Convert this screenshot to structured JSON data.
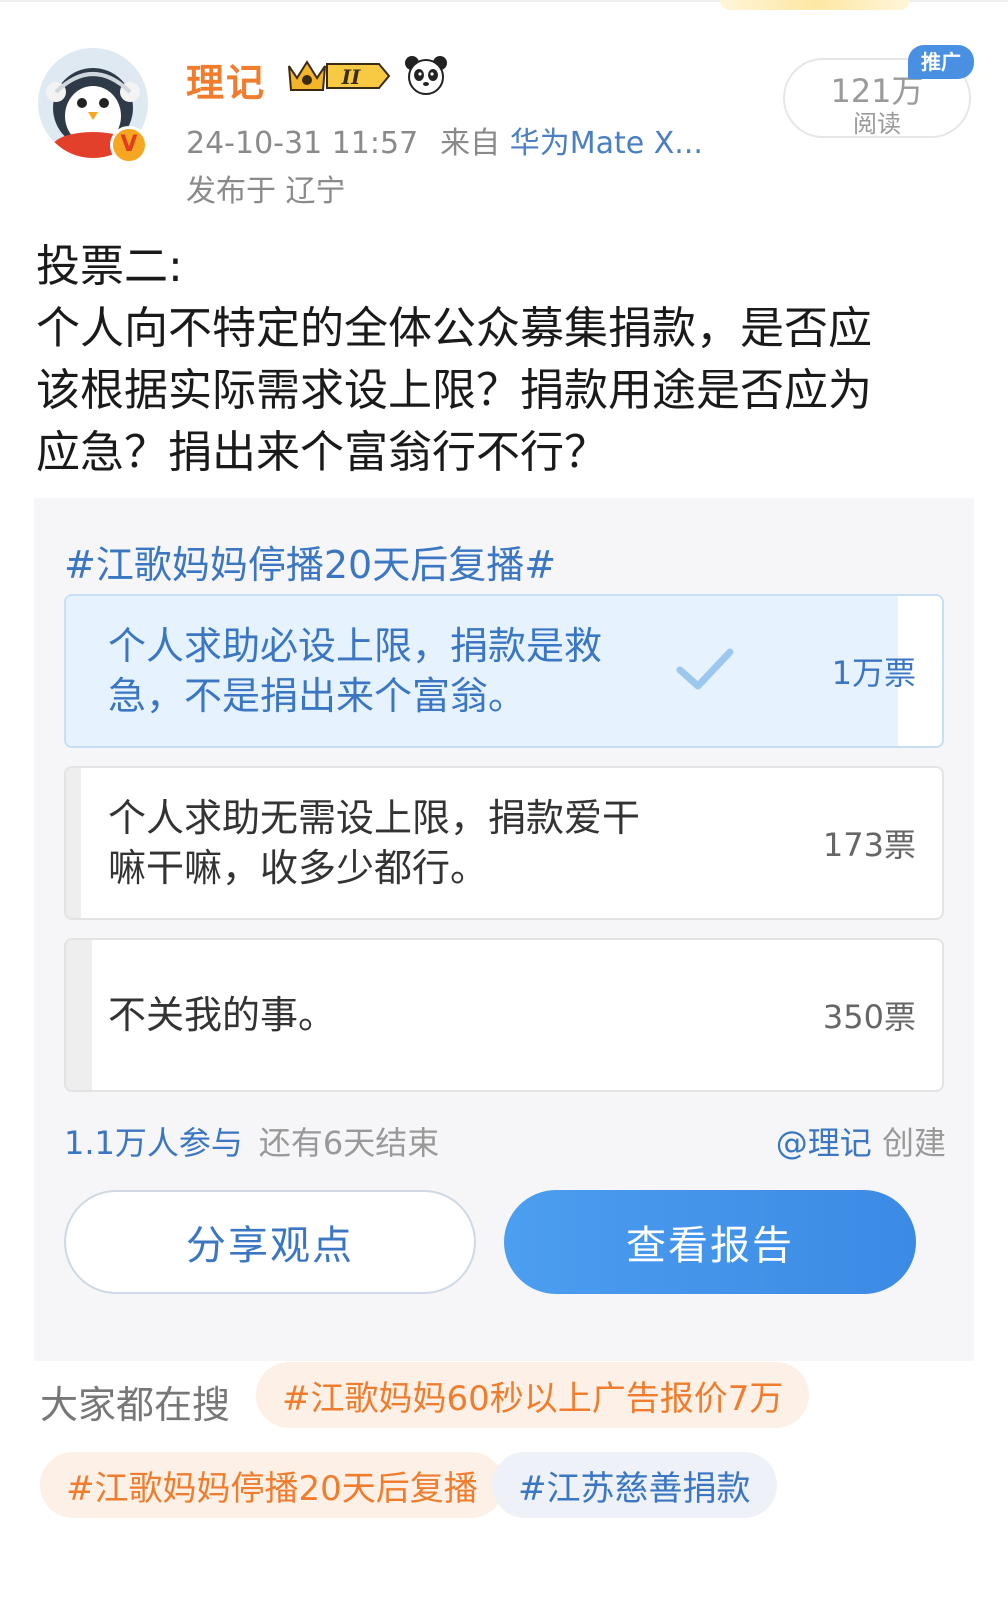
{
  "header": {
    "username": "理记",
    "level_badge": "II",
    "timestamp": "24-10-31 11:57",
    "source_prefix": "来自",
    "source_device": "华为Mate X...",
    "location": "发布于 辽宁",
    "read_count": "121万",
    "read_label": "阅读",
    "promo_tag": "推广",
    "verified_badge": "V"
  },
  "post": {
    "lines": [
      "投票二:",
      "个人向不特定的全体公众募集捐款，是否应",
      "该根据实际需求设上限？捐款用途是否应为",
      "应急？捐出来个富翁行不行？"
    ]
  },
  "poll": {
    "topic": "#江歌妈妈停播20天后复播#",
    "options": [
      {
        "text": "个人求助必设上限，捐款是救急，不是捐出来个富翁。",
        "votes": "1万票",
        "selected": true,
        "fill_ratio": 0.95
      },
      {
        "text": "个人求助无需设上限，捐款爱干嘛干嘛，收多少都行。",
        "votes": "173票",
        "selected": false,
        "fill_ratio": 0.017
      },
      {
        "text": "不关我的事。",
        "votes": "350票",
        "selected": false,
        "fill_ratio": 0.03
      }
    ],
    "participants": "1.1万人参与",
    "remaining": "还有6天结束",
    "creator_handle": "@理记",
    "creator_suffix": "创建",
    "share_button": "分享观点",
    "report_button": "查看报告"
  },
  "searches": {
    "label": "大家都在搜",
    "chips": [
      "#江歌妈妈60秒以上广告报价7万",
      "#江歌妈妈停播20天后复播",
      "#江苏慈善捐款"
    ]
  },
  "colors": {
    "accent_blue": "#3a76c1",
    "username_orange": "#f07d2e",
    "selected_fill": "#e6f3fe"
  }
}
